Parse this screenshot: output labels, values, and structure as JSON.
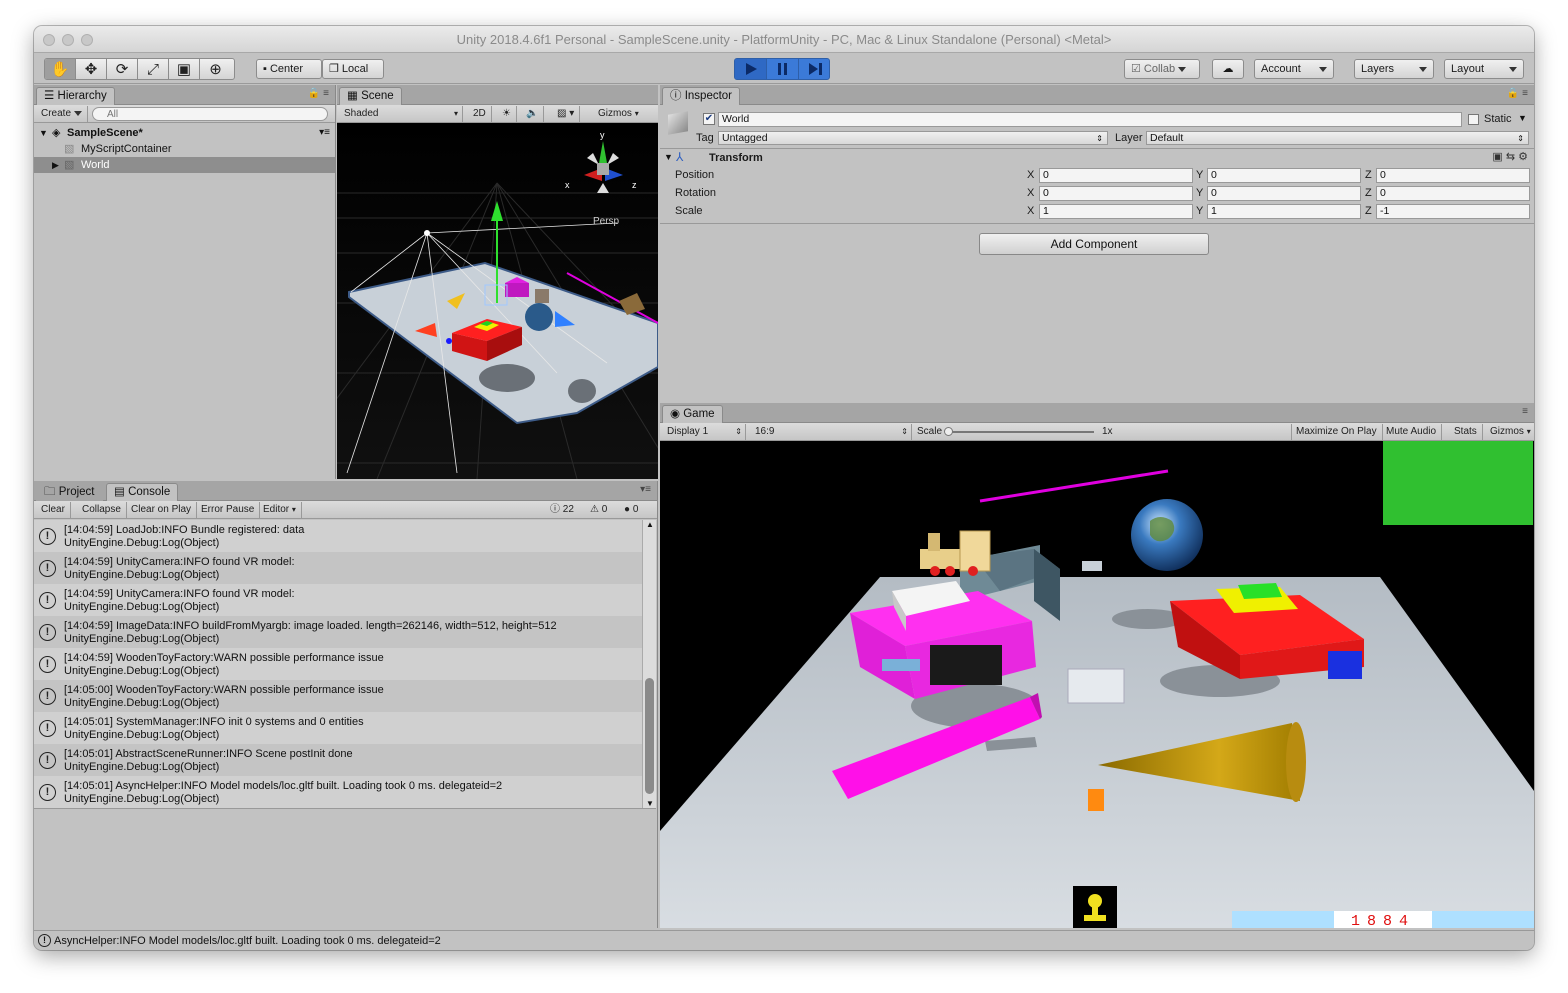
{
  "window": {
    "title": "Unity 2018.4.6f1 Personal - SampleScene.unity - PlatformUnity - PC, Mac & Linux Standalone (Personal) <Metal>"
  },
  "toolbar": {
    "tools": [
      "hand-tool-icon",
      "move-tool-icon",
      "rotate-tool-icon",
      "scale-tool-icon",
      "rect-tool-icon",
      "transform-tool-icon"
    ],
    "pivot_label": "Center",
    "space_label": "Local",
    "collab_label": "Collab",
    "account_label": "Account",
    "layers_label": "Layers",
    "layout_label": "Layout",
    "accent": "#3b7ad8"
  },
  "hierarchy": {
    "tab_label": "Hierarchy",
    "create_label": "Create",
    "search_placeholder": "All",
    "scene_name": "SampleScene*",
    "items": [
      "MyScriptContainer",
      "World"
    ]
  },
  "scene": {
    "tab_label": "Scene",
    "shading": "Shaded",
    "mode_2d": "2D",
    "gizmos_label": "Gizmos",
    "persp_label": "Persp",
    "axis_x": "x",
    "axis_y": "y",
    "axis_z": "z"
  },
  "inspector": {
    "tab_label": "Inspector",
    "object_name": "World",
    "static_label": "Static",
    "tag_label": "Tag",
    "tag_value": "Untagged",
    "layer_label": "Layer",
    "layer_value": "Default",
    "transform_label": "Transform",
    "rows": [
      {
        "label": "Position",
        "x": "0",
        "y": "0",
        "z": "0"
      },
      {
        "label": "Rotation",
        "x": "0",
        "y": "0",
        "z": "0"
      },
      {
        "label": "Scale",
        "x": "1",
        "y": "1",
        "z": "-1"
      }
    ],
    "add_component": "Add Component"
  },
  "console": {
    "project_tab": "Project",
    "console_tab": "Console",
    "buttons": [
      "Clear",
      "Collapse",
      "Clear on Play",
      "Error Pause",
      "Editor"
    ],
    "counts": {
      "warnings": "22",
      "alerts": "0",
      "errors": "0"
    },
    "entries": [
      {
        "line1": "[14:04:59] LoadJob:INFO  Bundle registered: data",
        "line2": "UnityEngine.Debug:Log(Object)"
      },
      {
        "line1": "[14:04:59] UnityCamera:INFO  found VR model:",
        "line2": "UnityEngine.Debug:Log(Object)"
      },
      {
        "line1": "[14:04:59] UnityCamera:INFO  found VR model:",
        "line2": "UnityEngine.Debug:Log(Object)"
      },
      {
        "line1": "[14:04:59] ImageData:INFO  buildFromMyargb: image loaded. length=262146, width=512, height=512",
        "line2": "UnityEngine.Debug:Log(Object)"
      },
      {
        "line1": "[14:04:59] WoodenToyFactory:WARN  possible performance issue",
        "line2": "UnityEngine.Debug:Log(Object)"
      },
      {
        "line1": "[14:05:00] WoodenToyFactory:WARN  possible performance issue",
        "line2": "UnityEngine.Debug:Log(Object)"
      },
      {
        "line1": "[14:05:01] SystemManager:INFO  init 0 systems and 0 entities",
        "line2": "UnityEngine.Debug:Log(Object)"
      },
      {
        "line1": "[14:05:01] AbstractSceneRunner:INFO  Scene postInit done",
        "line2": "UnityEngine.Debug:Log(Object)"
      },
      {
        "line1": "[14:05:01] AsyncHelper:INFO  Model models/loc.gltf built. Loading took 0 ms. delegateid=2",
        "line2": "UnityEngine.Debug:Log(Object)"
      }
    ]
  },
  "game": {
    "tab_label": "Game",
    "display": "Display 1",
    "aspect": "16:9",
    "scale_label": "Scale",
    "scale_value": "1x",
    "maximize": "Maximize On Play",
    "mute": "Mute Audio",
    "stats": "Stats",
    "gizmos": "Gizmos",
    "score": "1884"
  },
  "statusbar": {
    "message": "AsyncHelper:INFO  Model models/loc.gltf built. Loading took 0 ms. delegateid=2"
  }
}
